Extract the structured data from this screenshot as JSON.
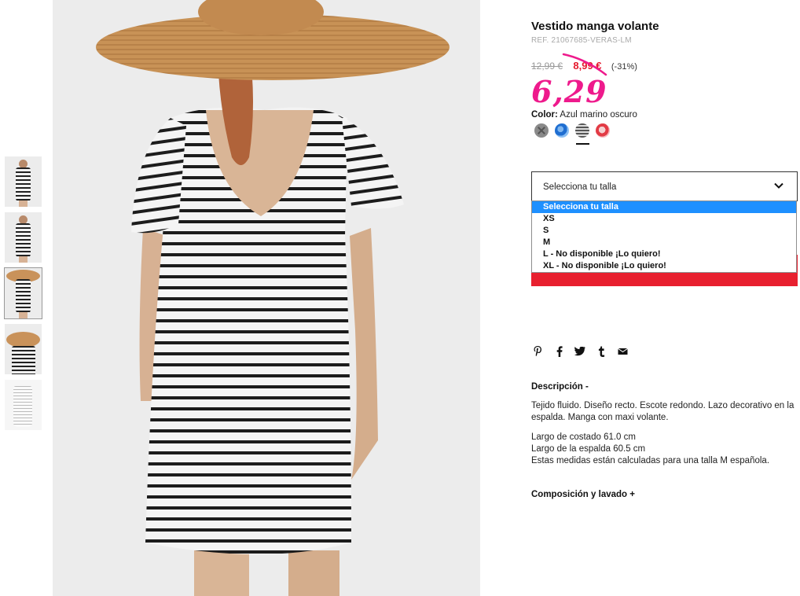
{
  "thumbnails": [
    {
      "alt": ""
    },
    {
      "alt": ""
    },
    {
      "alt": ""
    },
    {
      "alt": ""
    },
    {
      "alt": ""
    }
  ],
  "product": {
    "title": "Vestido manga volante",
    "ref": "REF. 21067685-VERAS-LM",
    "price_old": "12,99 €",
    "price_sale": "8,99 €",
    "discount": "(-31%)",
    "handwritten_price": "6,29",
    "color_label": "Color:",
    "color_value": "Azul marino oscuro",
    "swatches": [
      "grey-crossed",
      "blue-print",
      "navy-stripe",
      "red-print"
    ]
  },
  "size_select": {
    "label": "Selecciona tu talla",
    "options": [
      "Selecciona tu talla",
      "XS",
      "S",
      "M",
      "L - No disponible ¡Lo quiero!",
      "XL - No disponible ¡Lo quiero!"
    ],
    "selected_index": 0
  },
  "share_icons": [
    "pinterest-icon",
    "facebook-icon",
    "twitter-icon",
    "tumblr-icon",
    "email-icon"
  ],
  "description": {
    "heading": "Descripción -",
    "text": "Tejido fluido. Diseño recto. Escote redondo. Lazo decorativo en la espalda. Manga con maxi volante.",
    "measures": [
      "Largo de costado 61.0 cm",
      "Largo de la espalda 60.5 cm",
      "Estas medidas están calculadas para una talla M española."
    ]
  },
  "composition": {
    "heading": "Composición y lavado +"
  },
  "colors": {
    "sale_red": "#e5182c",
    "handwritten_pink": "#ee1a8c",
    "button_red": "#e8202f",
    "dropdown_highlight": "#1e90ff"
  }
}
